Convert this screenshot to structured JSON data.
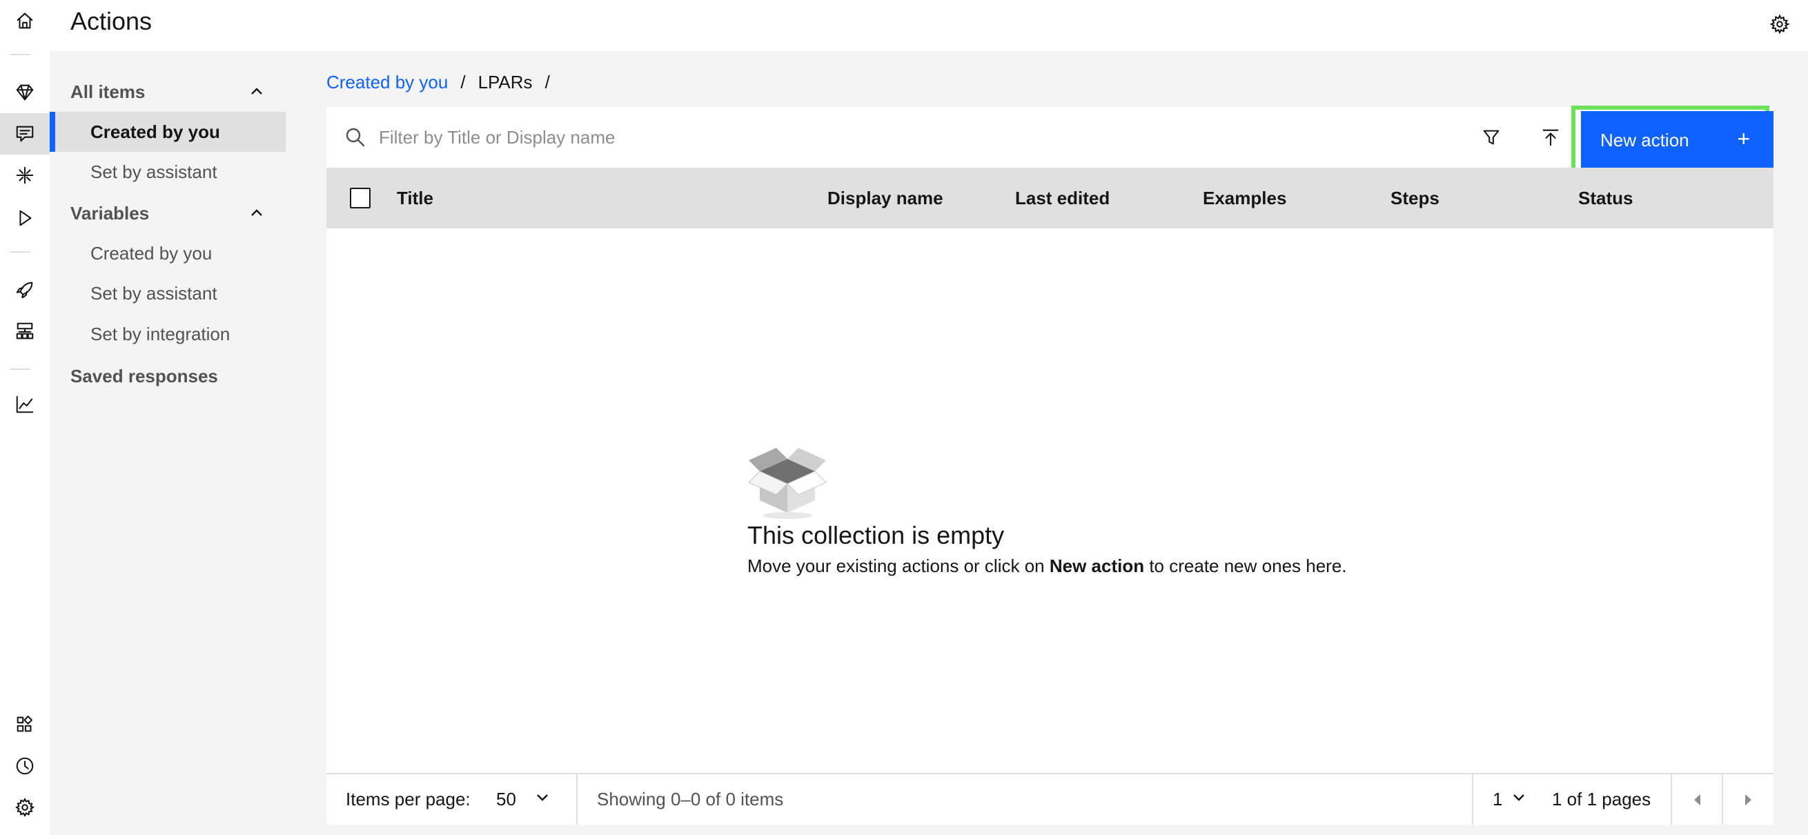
{
  "header": {
    "title": "Actions"
  },
  "rail": {
    "icons": [
      "home-icon",
      "diamond-icon",
      "chat-icon",
      "intents-icon",
      "play-icon",
      "rocket-icon",
      "integrations-icon",
      "analytics-icon",
      "apps-icon",
      "history-icon",
      "settings-icon"
    ],
    "active": "chat-icon"
  },
  "sidenav": {
    "all_items": {
      "label": "All items",
      "items": [
        {
          "label": "Created by you",
          "active": true
        },
        {
          "label": "Set by assistant",
          "active": false
        }
      ]
    },
    "variables": {
      "label": "Variables",
      "items": [
        {
          "label": "Created by you"
        },
        {
          "label": "Set by assistant"
        },
        {
          "label": "Set by integration"
        }
      ]
    },
    "saved_responses": {
      "label": "Saved responses"
    }
  },
  "breadcrumb": {
    "link": "Created by you",
    "separator": "/",
    "current": "LPARs",
    "trailing": "/"
  },
  "toolbar": {
    "search_placeholder": "Filter by Title or Display name",
    "new_action_label": "New action",
    "new_action_icon": "+"
  },
  "table": {
    "columns": [
      "Title",
      "Display name",
      "Last edited",
      "Examples",
      "Steps",
      "Status"
    ],
    "rows": []
  },
  "empty_state": {
    "title": "This collection is empty",
    "desc_prefix": "Move your existing actions or click on ",
    "desc_bold": "New action",
    "desc_suffix": " to create new ones here."
  },
  "pagination": {
    "items_per_page_label": "Items per page:",
    "items_per_page_value": "50",
    "showing": "Showing 0–0 of 0 items",
    "page_value": "1",
    "pages_text": "1 of 1 pages"
  },
  "colors": {
    "primary": "#0f62fe",
    "highlight": "#6ee15a",
    "header_row": "#e0e0e0"
  }
}
